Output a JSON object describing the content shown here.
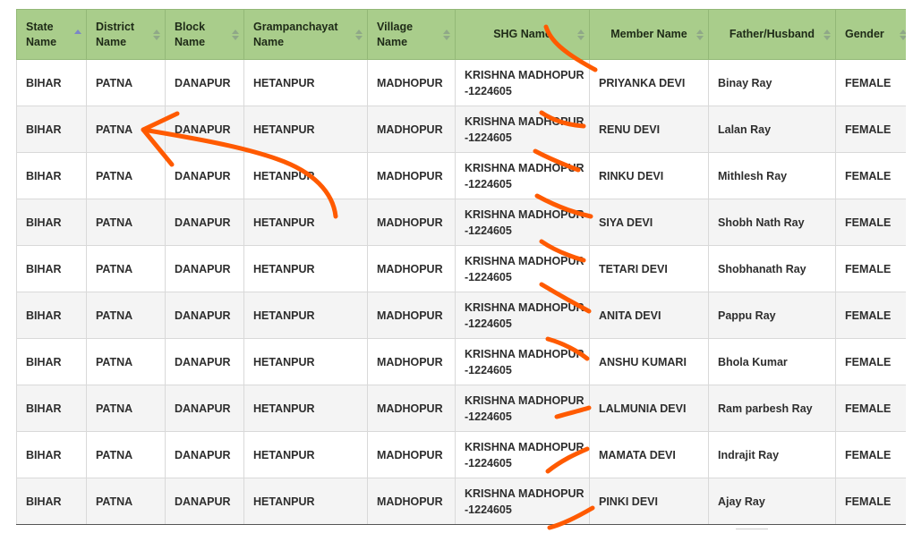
{
  "table": {
    "headers": [
      {
        "label_l1": "State",
        "label_l2": "Name"
      },
      {
        "label_l1": "District",
        "label_l2": "Name"
      },
      {
        "label_l1": "Block",
        "label_l2": "Name"
      },
      {
        "label_l1": "Grampanchayat",
        "label_l2": "Name"
      },
      {
        "label_l1": "Village",
        "label_l2": "Name"
      },
      {
        "label_l1": "SHG Name",
        "label_l2": ""
      },
      {
        "label_l1": "Member Name",
        "label_l2": ""
      },
      {
        "label_l1": "Father/Husband",
        "label_l2": ""
      },
      {
        "label_l1": "Gender",
        "label_l2": ""
      }
    ],
    "sorted_column": "State Name",
    "rows": [
      {
        "state": "BIHAR",
        "district": "PATNA",
        "block": "DANAPUR",
        "gp": "HETANPUR",
        "village": "MADHOPUR",
        "shg_l1": "KRISHNA MADHOPUR",
        "shg_l2": "-1224605",
        "member": "PRIYANKA DEVI",
        "relative": "Binay Ray",
        "gender": "FEMALE"
      },
      {
        "state": "BIHAR",
        "district": "PATNA",
        "block": "DANAPUR",
        "gp": "HETANPUR",
        "village": "MADHOPUR",
        "shg_l1": "KRISHNA MADHOPUR",
        "shg_l2": "-1224605",
        "member": "RENU DEVI",
        "relative": "Lalan Ray",
        "gender": "FEMALE"
      },
      {
        "state": "BIHAR",
        "district": "PATNA",
        "block": "DANAPUR",
        "gp": "HETANPUR",
        "village": "MADHOPUR",
        "shg_l1": "KRISHNA MADHOPUR",
        "shg_l2": "-1224605",
        "member": "RINKU DEVI",
        "relative": "Mithlesh Ray",
        "gender": "FEMALE"
      },
      {
        "state": "BIHAR",
        "district": "PATNA",
        "block": "DANAPUR",
        "gp": "HETANPUR",
        "village": "MADHOPUR",
        "shg_l1": "KRISHNA MADHOPUR",
        "shg_l2": "-1224605",
        "member": "SIYA DEVI",
        "relative": "Shobh Nath Ray",
        "gender": "FEMALE"
      },
      {
        "state": "BIHAR",
        "district": "PATNA",
        "block": "DANAPUR",
        "gp": "HETANPUR",
        "village": "MADHOPUR",
        "shg_l1": "KRISHNA MADHOPUR",
        "shg_l2": "-1224605",
        "member": "TETARI DEVI",
        "relative": "Shobhanath Ray",
        "gender": "FEMALE"
      },
      {
        "state": "BIHAR",
        "district": "PATNA",
        "block": "DANAPUR",
        "gp": "HETANPUR",
        "village": "MADHOPUR",
        "shg_l1": "KRISHNA MADHOPUR",
        "shg_l2": "-1224605",
        "member": "ANITA DEVI",
        "relative": "Pappu Ray",
        "gender": "FEMALE"
      },
      {
        "state": "BIHAR",
        "district": "PATNA",
        "block": "DANAPUR",
        "gp": "HETANPUR",
        "village": "MADHOPUR",
        "shg_l1": "KRISHNA MADHOPUR",
        "shg_l2": "-1224605",
        "member": "ANSHU KUMARI",
        "relative": "Bhola Kumar",
        "gender": "FEMALE"
      },
      {
        "state": "BIHAR",
        "district": "PATNA",
        "block": "DANAPUR",
        "gp": "HETANPUR",
        "village": "MADHOPUR",
        "shg_l1": "KRISHNA MADHOPUR",
        "shg_l2": "-1224605",
        "member": "LALMUNIA DEVI",
        "relative": "Ram parbesh Ray",
        "gender": "FEMALE"
      },
      {
        "state": "BIHAR",
        "district": "PATNA",
        "block": "DANAPUR",
        "gp": "HETANPUR",
        "village": "MADHOPUR",
        "shg_l1": "KRISHNA MADHOPUR",
        "shg_l2": "-1224605",
        "member": "MAMATA DEVI",
        "relative": "Indrajit Ray",
        "gender": "FEMALE"
      },
      {
        "state": "BIHAR",
        "district": "PATNA",
        "block": "DANAPUR",
        "gp": "HETANPUR",
        "village": "MADHOPUR",
        "shg_l1": "KRISHNA MADHOPUR",
        "shg_l2": "-1224605",
        "member": "PINKI DEVI",
        "relative": "Ajay Ray",
        "gender": "FEMALE"
      }
    ]
  },
  "colors": {
    "header_bg": "#a9cd8b",
    "row_alt_bg": "#f4f4f4",
    "annotation_stroke": "#ff5a00",
    "sort_active": "#7b86c7"
  },
  "icons": {
    "sort": "sort-arrows-icon",
    "annotation": "orange-pen-annotation-icon"
  }
}
